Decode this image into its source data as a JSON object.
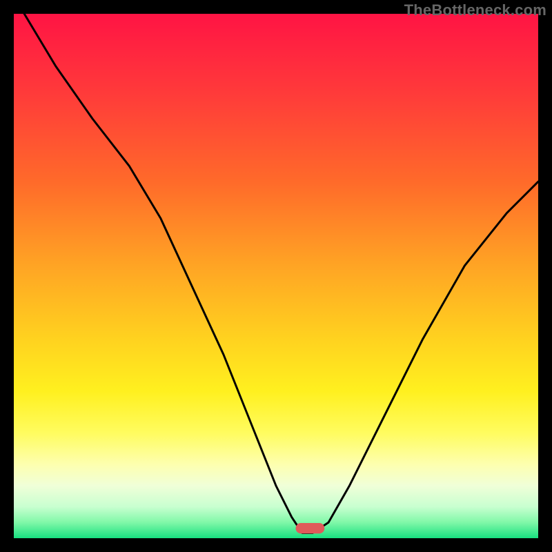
{
  "watermark": "TheBottleneck.com",
  "gradient_stops": [
    {
      "offset": 0,
      "color": "#ff1444"
    },
    {
      "offset": 15,
      "color": "#ff3a3a"
    },
    {
      "offset": 32,
      "color": "#ff6a2a"
    },
    {
      "offset": 48,
      "color": "#ffa424"
    },
    {
      "offset": 62,
      "color": "#ffd21f"
    },
    {
      "offset": 72,
      "color": "#fff01f"
    },
    {
      "offset": 80,
      "color": "#fffc60"
    },
    {
      "offset": 86,
      "color": "#fdffb0"
    },
    {
      "offset": 90,
      "color": "#f0ffd8"
    },
    {
      "offset": 94,
      "color": "#c8ffd0"
    },
    {
      "offset": 97,
      "color": "#80f8a8"
    },
    {
      "offset": 100,
      "color": "#18e080"
    }
  ],
  "marker": {
    "x_pct": 56.5,
    "y_pct": 98.1,
    "width_pct": 5.5,
    "height_pct": 2.0,
    "rx_pct": 1.0,
    "color": "#e05a5a"
  },
  "chart_data": {
    "type": "line",
    "title": "",
    "xlabel": "",
    "ylabel": "",
    "xlim": [
      0,
      100
    ],
    "ylim": [
      0,
      100
    ],
    "series": [
      {
        "name": "bottleneck-curve",
        "x": [
          2,
          8,
          15,
          22,
          28,
          34,
          40,
          46,
          50,
          53,
          55,
          57,
          60,
          64,
          70,
          78,
          86,
          94,
          100
        ],
        "y": [
          100,
          90,
          80,
          71,
          61,
          48,
          35,
          20,
          10,
          4,
          1,
          1,
          3,
          10,
          22,
          38,
          52,
          62,
          68
        ]
      }
    ],
    "optimal_x": 56.5
  }
}
